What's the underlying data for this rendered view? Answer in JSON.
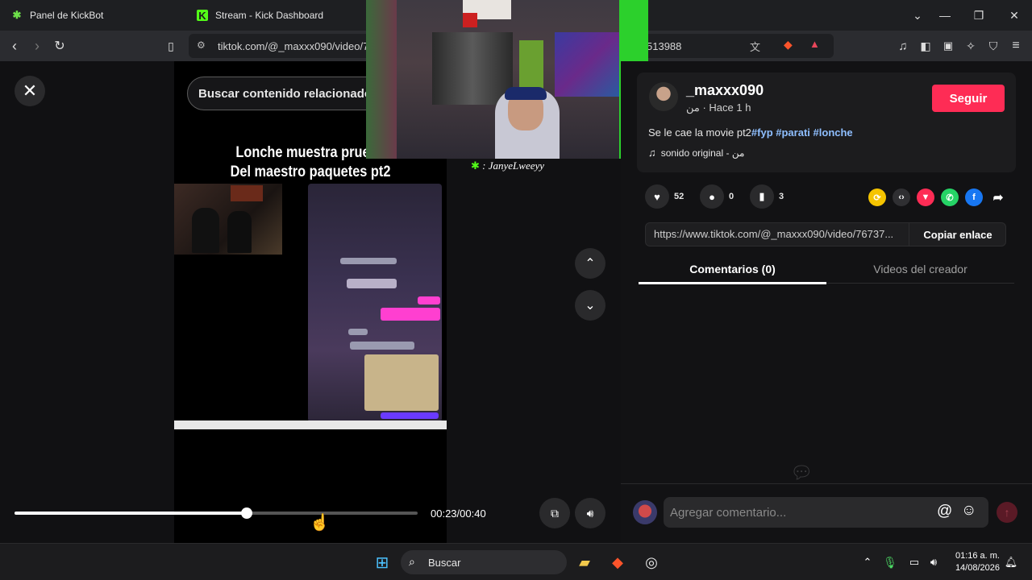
{
  "browser": {
    "tabs": [
      {
        "title": "Panel de KickBot"
      },
      {
        "title": "Stream - Kick Dashboard"
      }
    ],
    "url_left": "tiktok.com/@_maxxx090/video/7",
    "url_right": "513988"
  },
  "player": {
    "search_placeholder": "Buscar contenido relacionado",
    "caption_line1": "Lonche muestra prueba",
    "caption_line2": "Del maestro paquetes pt2",
    "timecode": "00:23/00:40",
    "progress": 0.575
  },
  "stream_overlay": {
    "chat_name": ": JanyeLweeyy"
  },
  "post": {
    "username": "_maxxx090",
    "subline": "من · Hace 1 h",
    "follow_label": "Seguir",
    "description_text": "Se le cae la movie pt2",
    "hashtags": [
      "#fyp",
      "#parati",
      "#lonche"
    ],
    "sound": "sonido original - من",
    "likes": "52",
    "comments": "0",
    "saves": "3",
    "link": "https://www.tiktok.com/@_maxxx090/video/76737...",
    "copy_label": "Copiar enlace",
    "tab_comments": "Comentarios (0)",
    "tab_creator": "Videos del creador",
    "comment_placeholder": "Agregar comentario..."
  },
  "taskbar": {
    "search_label": "Buscar",
    "time": "01:16 a. m.",
    "date": "14/08/2026"
  },
  "colors": {
    "follow": "#fe2c55",
    "hashtag": "#8fbfff"
  }
}
